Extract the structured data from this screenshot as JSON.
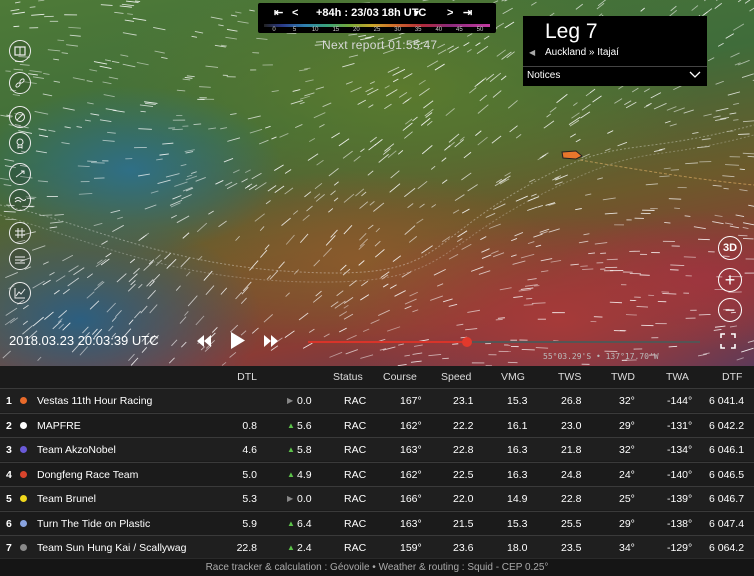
{
  "scale": {
    "time_label": "+84h : 23/03 18h UTC",
    "ticks": [
      "0",
      "5",
      "10",
      "15",
      "20",
      "25",
      "30",
      "35",
      "40",
      "45",
      "50"
    ]
  },
  "next_report": "Next report 01:55:47",
  "leg": {
    "title": "Leg 7",
    "route": "Auckland » Itajaí",
    "notices_label": "Notices"
  },
  "playback": {
    "datetime": "2018.03.23 20:03:39 UTC",
    "progress": 0.405,
    "coords": "55°03.29'S • 137°17.70'W"
  },
  "right_tools": {
    "view3d_label": "3D"
  },
  "table": {
    "headers": {
      "dtl": "DTL",
      "status": "Status",
      "course": "Course",
      "speed": "Speed",
      "vmg": "VMG",
      "tws": "TWS",
      "twd": "TWD",
      "twa": "TWA",
      "dtf": "DTF"
    },
    "rows": [
      {
        "rank": "1",
        "name": "Vestas 11th Hour Racing",
        "color": "#e86a2a",
        "dtl": "",
        "trend": "pause",
        "delta": "0.0",
        "status": "RAC",
        "course": "167°",
        "speed": "23.1",
        "vmg": "15.3",
        "tws": "26.8",
        "twd": "32°",
        "twa": "-144°",
        "dtf": "6 041.4"
      },
      {
        "rank": "2",
        "name": "MAPFRE",
        "color": "#ffffff",
        "dtl": "0.8",
        "trend": "up",
        "delta": "5.6",
        "status": "RAC",
        "course": "162°",
        "speed": "22.2",
        "vmg": "16.1",
        "tws": "23.0",
        "twd": "29°",
        "twa": "-131°",
        "dtf": "6 042.2"
      },
      {
        "rank": "3",
        "name": "Team AkzoNobel",
        "color": "#6a5ad8",
        "dtl": "4.6",
        "trend": "up",
        "delta": "5.8",
        "status": "RAC",
        "course": "163°",
        "speed": "22.8",
        "vmg": "16.3",
        "tws": "21.8",
        "twd": "32°",
        "twa": "-134°",
        "dtf": "6 046.1"
      },
      {
        "rank": "4",
        "name": "Dongfeng Race Team",
        "color": "#d8442c",
        "dtl": "5.0",
        "trend": "up",
        "delta": "4.9",
        "status": "RAC",
        "course": "162°",
        "speed": "22.5",
        "vmg": "16.3",
        "tws": "24.8",
        "twd": "24°",
        "twa": "-140°",
        "dtf": "6 046.5"
      },
      {
        "rank": "5",
        "name": "Team Brunel",
        "color": "#f0d81c",
        "dtl": "5.3",
        "trend": "pause",
        "delta": "0.0",
        "status": "RAC",
        "course": "166°",
        "speed": "22.0",
        "vmg": "14.9",
        "tws": "22.8",
        "twd": "25°",
        "twa": "-139°",
        "dtf": "6 046.7"
      },
      {
        "rank": "6",
        "name": "Turn The Tide on Plastic",
        "color": "#8aa4e0",
        "dtl": "5.9",
        "trend": "up",
        "delta": "6.4",
        "status": "RAC",
        "course": "163°",
        "speed": "21.5",
        "vmg": "15.3",
        "tws": "25.5",
        "twd": "29°",
        "twa": "-138°",
        "dtf": "6 047.4"
      },
      {
        "rank": "7",
        "name": "Team Sun Hung Kai / Scallywag",
        "color": "#8a8a8a",
        "dtl": "22.8",
        "trend": "up",
        "delta": "2.4",
        "status": "RAC",
        "course": "159°",
        "speed": "23.6",
        "vmg": "18.0",
        "tws": "23.5",
        "twd": "34°",
        "twa": "-129°",
        "dtf": "6 064.2"
      }
    ]
  },
  "footer": "Race tracker & calculation : Géovoile • Weather & routing : Squid - CEP 0.25°"
}
